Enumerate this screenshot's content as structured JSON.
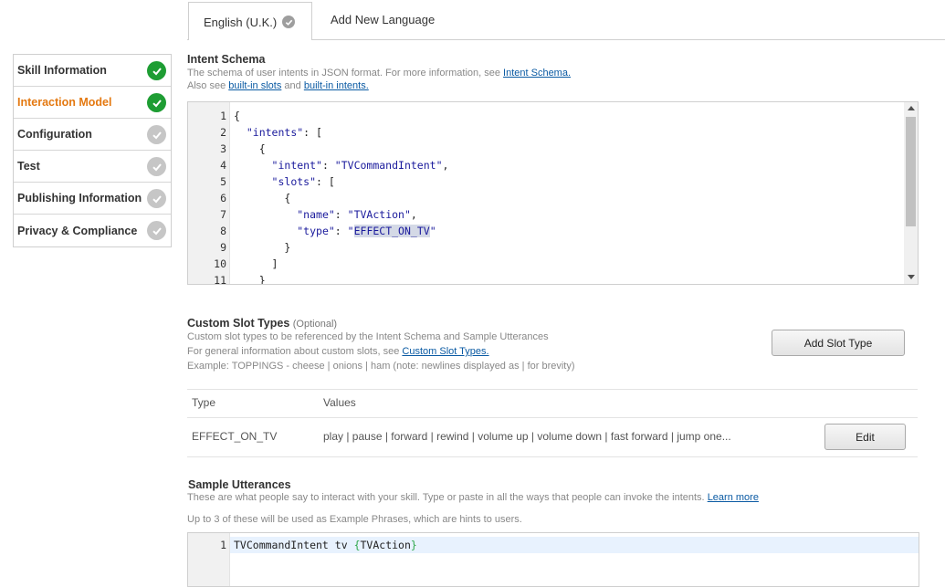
{
  "tabs": {
    "active_label": "English (U.K.)",
    "add_label": "Add New Language"
  },
  "sidebar": {
    "items": [
      {
        "label": "Skill Information",
        "status": "complete"
      },
      {
        "label": "Interaction Model",
        "status": "complete"
      },
      {
        "label": "Configuration",
        "status": "incomplete"
      },
      {
        "label": "Test",
        "status": "incomplete"
      },
      {
        "label": "Publishing Information",
        "status": "incomplete"
      },
      {
        "label": "Privacy & Compliance",
        "status": "incomplete"
      }
    ]
  },
  "intent_schema": {
    "title": "Intent Schema",
    "desc1": "The schema of user intents in JSON format. For more information, see",
    "desc1_link": "Intent Schema.",
    "desc2_prefix": "Also see",
    "builtin_slots_link": "built-in slots",
    "desc2_and": "and",
    "builtin_intents_link": "built-in intents.",
    "lines": [
      {
        "n": "1",
        "text": "{"
      },
      {
        "n": "2",
        "text": "  \"intents\": ["
      },
      {
        "n": "3",
        "text": "    {"
      },
      {
        "n": "4",
        "text": "      \"intent\": \"TVCommandIntent\","
      },
      {
        "n": "5",
        "text": "      \"slots\": ["
      },
      {
        "n": "6",
        "text": "        {"
      },
      {
        "n": "7",
        "text": "          \"name\": \"TVAction\","
      },
      {
        "n": "8",
        "text": "          \"type\": \"EFFECT_ON_TV\""
      },
      {
        "n": "9",
        "text": "        }"
      },
      {
        "n": "10",
        "text": "      ]"
      },
      {
        "n": "11",
        "text": "    }"
      }
    ]
  },
  "custom_slots": {
    "title": "Custom Slot Types",
    "optional": "(Optional)",
    "desc1": "Custom slot types to be referenced by the Intent Schema and Sample Utterances",
    "desc2_prefix": "For general information about custom slots, see",
    "desc2_link": "Custom Slot Types.",
    "desc3": "Example: TOPPINGS - cheese | onions | ham (note: newlines displayed as | for brevity)",
    "add_button": "Add Slot Type",
    "col_type": "Type",
    "col_values": "Values",
    "rows": [
      {
        "type": "EFFECT_ON_TV",
        "values": "play | pause | forward | rewind | volume up | volume down | fast forward | jump one...",
        "edit": "Edit"
      }
    ]
  },
  "utterances": {
    "title": "Sample Utterances",
    "desc1": "These are what people say to interact with your skill. Type or paste in all the ways that people can invoke the intents.",
    "learn_more": "Learn more",
    "desc2": "Up to 3 of these will be used as Example Phrases, which are hints to users.",
    "line_number": "1",
    "line_prefix": "TVCommandIntent tv ",
    "open_brace": "{",
    "slot": "TVAction",
    "close_brace": "}"
  },
  "colors": {
    "complete": "#1e9d33",
    "incomplete": "#c6c6c6",
    "active_nav": "#e47911",
    "link": "#0a5aa3"
  }
}
